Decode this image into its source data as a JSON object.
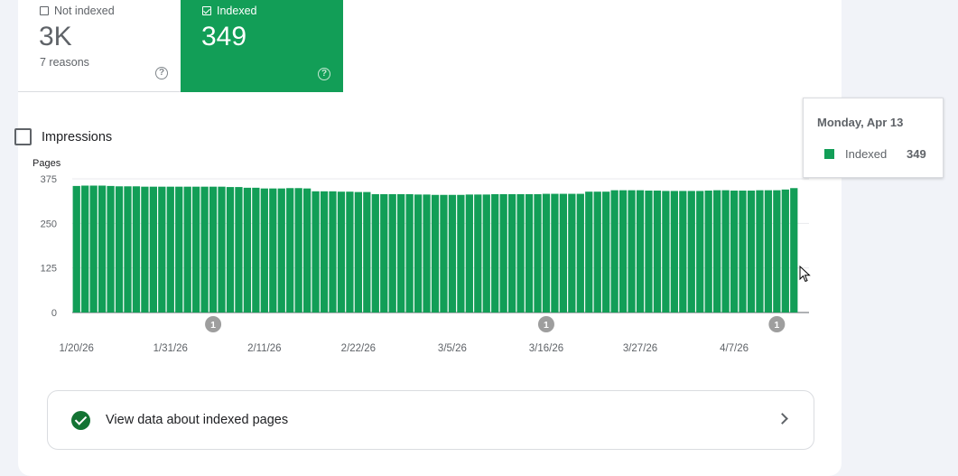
{
  "tiles": {
    "not_indexed": {
      "label": "Not indexed",
      "value": "3K",
      "sub": "7 reasons",
      "help": "?"
    },
    "indexed": {
      "label": "Indexed",
      "value": "349",
      "help": "?"
    }
  },
  "impressions": {
    "label": "Impressions",
    "checked": false
  },
  "tooltip": {
    "date": "Monday, Apr 13",
    "series_name": "Indexed",
    "value": "349"
  },
  "view_link": {
    "label": "View data about indexed pages"
  },
  "colors": {
    "bar": "#129e57",
    "marker": "#9e9e9e",
    "accent": "#129e57"
  },
  "chart_data": {
    "type": "bar",
    "ylabel": "Pages",
    "yticks": [
      0,
      125,
      250,
      375
    ],
    "ylim": [
      0,
      375
    ],
    "xticks": [
      "1/20/26",
      "1/31/26",
      "2/11/26",
      "2/22/26",
      "3/5/26",
      "3/16/26",
      "3/27/26",
      "4/7/26"
    ],
    "start_date": "2026-01-20",
    "end_date": "2026-04-13",
    "series": [
      {
        "name": "Indexed",
        "values": [
          355,
          356,
          356,
          356,
          355,
          354,
          354,
          354,
          353,
          353,
          353,
          353,
          353,
          353,
          353,
          353,
          353,
          353,
          352,
          352,
          350,
          350,
          348,
          348,
          348,
          349,
          349,
          348,
          340,
          340,
          340,
          339,
          339,
          338,
          338,
          332,
          332,
          332,
          332,
          332,
          331,
          331,
          330,
          330,
          330,
          330,
          331,
          331,
          331,
          332,
          332,
          332,
          332,
          332,
          332,
          333,
          333,
          333,
          333,
          333,
          339,
          339,
          339,
          343,
          343,
          343,
          343,
          342,
          342,
          341,
          341,
          341,
          341,
          341,
          342,
          343,
          343,
          342,
          342,
          342,
          343,
          343,
          343,
          345,
          349
        ]
      }
    ],
    "annotations": [
      {
        "date": "2/5/26",
        "label": "1"
      },
      {
        "date": "3/16/26",
        "label": "1"
      },
      {
        "date": "4/12/26",
        "label": "1"
      }
    ]
  }
}
